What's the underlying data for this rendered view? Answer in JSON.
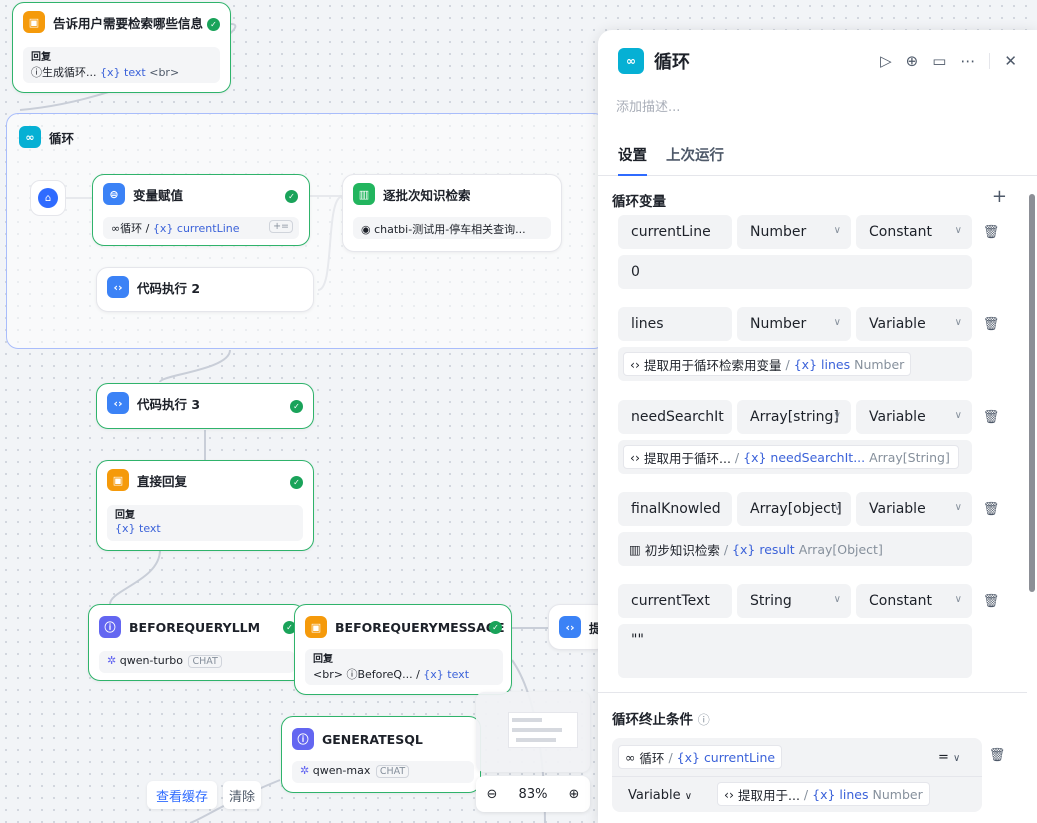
{
  "canvas": {
    "node_reply1": {
      "title": "告诉用户需要检索哪些信息",
      "sub_label": "回复",
      "sub_text": "生成循环...",
      "var": "text",
      "tail": "<br>"
    },
    "loop": {
      "title": "循环"
    },
    "node_assign": {
      "title": "变量赋值",
      "sub_prefix": "∞循环",
      "var": "currentLine",
      "op": "+="
    },
    "node_kb": {
      "title": "逐批次知识检索",
      "sub_text": "chatbi-测试用-停车相关查询..."
    },
    "node_code2": {
      "title": "代码执行 2"
    },
    "node_code3": {
      "title": "代码执行 3"
    },
    "node_direct": {
      "title": "直接回复",
      "sub_label": "回复",
      "var": "text"
    },
    "node_llm1": {
      "title": "BEFOREQUERYLLM",
      "model": "qwen-turbo",
      "tag": "CHAT"
    },
    "node_msg": {
      "title": "BEFOREQUERYMESSAGE",
      "sub_label": "回复",
      "br": "<br>",
      "ref": "BeforeQ...",
      "var": "text"
    },
    "node_cut": {
      "title": "提"
    },
    "node_sql": {
      "title": "GENERATESQL",
      "model": "qwen-max",
      "tag": "CHAT"
    },
    "btn_cache": "查看缓存",
    "btn_clear": "清除",
    "zoom": "83%"
  },
  "panel": {
    "title": "循环",
    "desc_placeholder": "添加描述...",
    "tabs": [
      "设置",
      "上次运行"
    ],
    "section_vars": "循环变量",
    "vars": [
      {
        "name": "currentLine",
        "type": "Number",
        "mode": "Constant",
        "value": "0"
      },
      {
        "name": "lines",
        "type": "Number",
        "mode": "Variable",
        "ref_node": "提取用于循环检索用变量",
        "ref_var": "lines",
        "ref_type": "Number"
      },
      {
        "name": "needSearchIt",
        "type": "Array[string]",
        "mode": "Variable",
        "ref_node": "提取用于循环...",
        "ref_var": "needSearchIt...",
        "ref_type": "Array[String]"
      },
      {
        "name": "finalKnowled",
        "type": "Array[object]",
        "mode": "Variable",
        "ref_node": "初步知识检索",
        "ref_var": "result",
        "ref_type": "Array[Object]"
      },
      {
        "name": "currentText",
        "type": "String",
        "mode": "Constant",
        "value": "\"\""
      }
    ],
    "section_stop": "循环终止条件",
    "cond": {
      "left_prefix": "循环",
      "left_var": "currentLine",
      "op": "=",
      "mode": "Variable",
      "ref_node": "提取用于...",
      "ref_var": "lines",
      "ref_type": "Number"
    }
  },
  "colors": {
    "accent": "#2f6bff",
    "success": "#1aa35a",
    "loop": "#06b0d4"
  }
}
